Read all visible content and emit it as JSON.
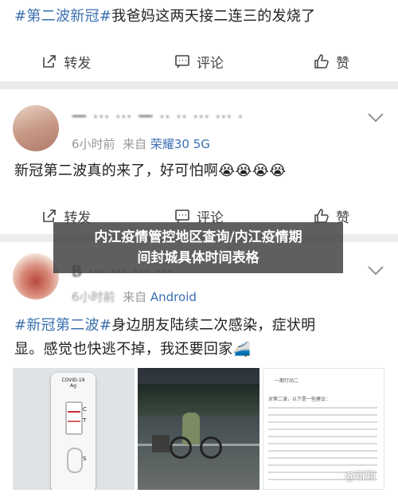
{
  "post1": {
    "topic": "#第二波新冠#",
    "text": "我爸妈这两天接二连三的发烧了"
  },
  "actions": {
    "repost": "转发",
    "comment": "评论",
    "like": "赞"
  },
  "post2": {
    "name": "一 ··· ··· 一 ·· ·· ··· ··· ·",
    "time": "6小时前",
    "from": "来自",
    "device": "荣耀30 5G",
    "text": "新冠第二波真的来了，好可怕啊",
    "emoji": "😭😭😭😭"
  },
  "overlay": {
    "line1": "内江疫情管控地区查询/内江疫情期",
    "line2": "间封城具体时间表格"
  },
  "post3": {
    "name": "B ··· ··· ··· ···",
    "time": "6小时前",
    "from": "来自",
    "device": "Android",
    "topic": "#新冠第二波#",
    "text1": "身边朋友陆续二次感染，症状明",
    "text2": "显。感觉也快逃不掉，我还要回家",
    "emoji": "🚄"
  },
  "test_kit": {
    "brand": "COVID-19",
    "sub": "Ag",
    "c_label": "C",
    "t_label": "T",
    "s_label": "S"
  },
  "document": {
    "header": "一期行动二",
    "line1": "对第二波，以下是一些建议："
  },
  "watermark": "@新颗"
}
